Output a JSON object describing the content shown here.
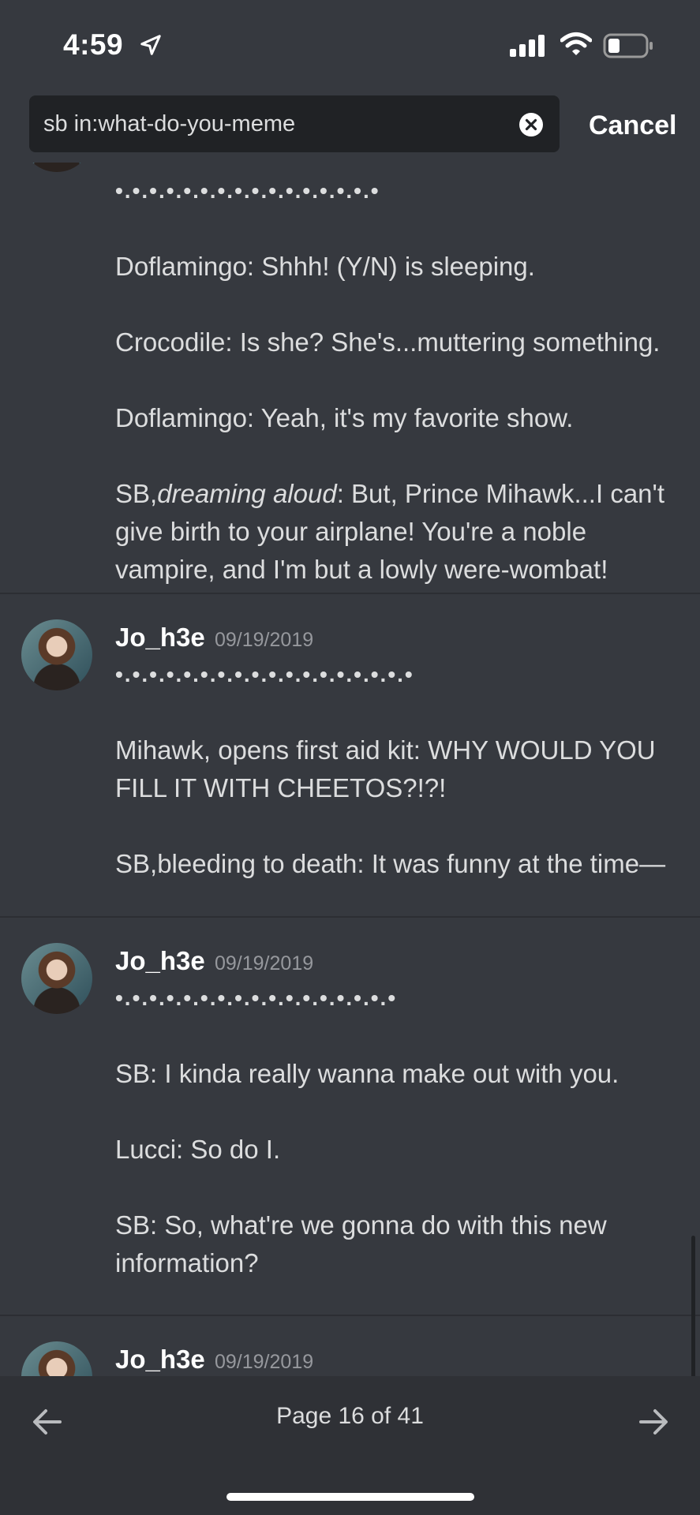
{
  "status": {
    "time": "4:59"
  },
  "search": {
    "query": "sb in:what-do-you-meme",
    "cancel_label": "Cancel"
  },
  "messages": [
    {
      "dots": "•.•.•.•.•.•.•.•.•.•.•.•.•.•.•.•",
      "lines": [
        "Doflamingo: Shhh! (Y/N) is sleeping.",
        "Crocodile: Is she? She's...muttering something.",
        "Doflamingo: Yeah, it's my favorite show."
      ],
      "last_prefix": "SB,",
      "last_italic": "dreaming aloud",
      "last_rest": ": But, Prince Mihawk...I can't give birth to your airplane! You're a noble vampire, and I'm but a lowly were-wombat!"
    },
    {
      "author": "Jo_h3e",
      "date": "09/19/2019",
      "dots": "•.•.•.•.•.•.•.•.•.•.•.•.•.•.•.•.•.•",
      "lines": [
        "Mihawk, opens first aid kit: WHY WOULD YOU FILL IT WITH CHEETOS?!?!",
        "SB,bleeding to death: It was funny at the time—"
      ]
    },
    {
      "author": "Jo_h3e",
      "date": "09/19/2019",
      "dots": "•.•.•.•.•.•.•.•.•.•.•.•.•.•.•.•.•",
      "lines": [
        "SB: I kinda really wanna make out with you.",
        "Lucci: So do I.",
        "SB: So, what're we gonna do with this new information?"
      ]
    },
    {
      "author": "Jo_h3e",
      "date": "09/19/2019"
    }
  ],
  "pagination": {
    "label": "Page 16 of 41"
  },
  "icons": {
    "location": "location-arrow-icon",
    "signal": "cellular-signal-icon",
    "wifi": "wifi-icon",
    "battery": "battery-icon",
    "clear": "clear-search-icon",
    "prev": "arrow-left-icon",
    "next": "arrow-right-icon"
  }
}
